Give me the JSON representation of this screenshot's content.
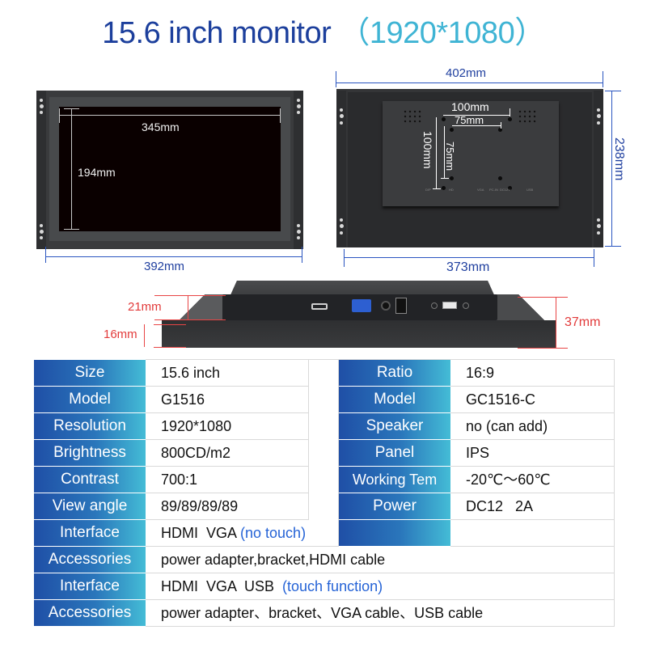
{
  "title": {
    "main": "15.6 inch monitor",
    "resolution": "（1920*1080）"
  },
  "front_view": {
    "screen_width": "345mm",
    "screen_height": "194mm",
    "overall_width": "392mm"
  },
  "back_view": {
    "overall_width": "402mm",
    "body_width": "373mm",
    "height": "238mm",
    "vesa_outer_h": "100mm",
    "vesa_inner_h": "75mm",
    "vesa_outer_v": "100mm",
    "vesa_inner_v": "75mm",
    "port_labels": [
      "D/P",
      "HD",
      "VGA",
      "PC-IN",
      "DC12V",
      "USB"
    ]
  },
  "side_view": {
    "io_depth": "21mm",
    "frame_depth": "16mm",
    "total_depth": "37mm",
    "ports": [
      "hdmi-port",
      "vga-port",
      "audio-jack",
      "dc-power-jack",
      "button",
      "usb-port",
      "button"
    ]
  },
  "colors": {
    "title_dark": "#1c3f9c",
    "title_light": "#3fb4d4",
    "dim_blue": "#1f3f9f",
    "dim_red": "#e23a3a",
    "header_gradient_start": "#1f4fa6",
    "header_gradient_end": "#44bcd6",
    "note_blue": "#2563d6"
  },
  "spec_table": {
    "left": [
      {
        "label": "Size",
        "value": "15.6 inch"
      },
      {
        "label": "Model",
        "value": "G1516"
      },
      {
        "label": "Resolution",
        "value": "1920*1080"
      },
      {
        "label": "Brightness",
        "value": "800CD/m2"
      },
      {
        "label": "Contrast",
        "value": "700:1"
      },
      {
        "label": "View angle",
        "value": "89/89/89/89"
      }
    ],
    "right": [
      {
        "label": "Ratio",
        "value": "16:9"
      },
      {
        "label": "Model",
        "value": "GC1516-C"
      },
      {
        "label": "Speaker",
        "value": "no (can add)"
      },
      {
        "label": "Panel",
        "value": "IPS"
      },
      {
        "label": "Working Tem",
        "value": "-20℃～60℃"
      },
      {
        "label": "Power",
        "value": "DC12   2A"
      },
      {
        "label": "",
        "value": ""
      }
    ],
    "full_rows": [
      {
        "label": "Interface",
        "value": "HDMI  VGA ",
        "note": "(no touch)"
      },
      {
        "label": "Accessories",
        "value": "power adapter,bracket,HDMI cable",
        "note": ""
      },
      {
        "label": "Interface",
        "value": "HDMI  VGA  USB  ",
        "note": "(touch function)"
      },
      {
        "label": "Accessories",
        "value": "power adapter、bracket、VGA cable、USB cable",
        "note": ""
      }
    ]
  }
}
